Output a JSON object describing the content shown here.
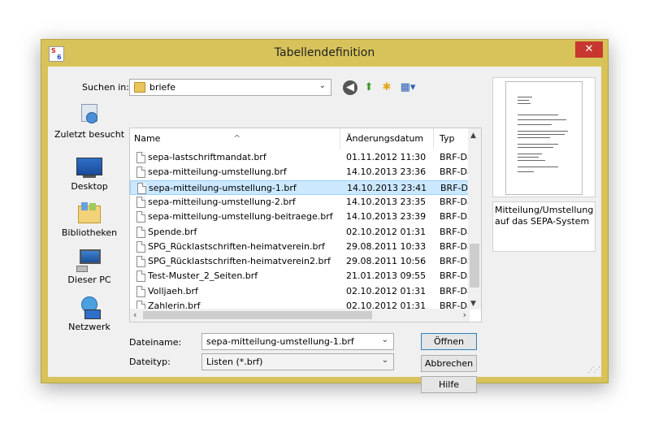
{
  "window": {
    "title": "Tabellendefinition",
    "close_glyph": "✕",
    "icon_s": "S",
    "icon_n": "6"
  },
  "lookin": {
    "label": "Suchen in:",
    "value": "briefe"
  },
  "places": [
    {
      "label": "Zuletzt besucht",
      "icon": "recent-places-icon"
    },
    {
      "label": "Desktop",
      "icon": "desktop-icon"
    },
    {
      "label": "Bibliotheken",
      "icon": "libraries-icon"
    },
    {
      "label": "Dieser PC",
      "icon": "this-pc-icon"
    },
    {
      "label": "Netzwerk",
      "icon": "network-icon"
    }
  ],
  "columns": {
    "name": "Name",
    "date": "Änderungsdatum",
    "type": "Typ"
  },
  "files": [
    {
      "name": "sepa-lastschriftmandat.brf",
      "date": "01.11.2012 11:30",
      "type": "BRF-Datei"
    },
    {
      "name": "sepa-mitteilung-umstellung.brf",
      "date": "14.10.2013 23:36",
      "type": "BRF-Datei"
    },
    {
      "name": "sepa-mitteilung-umstellung-1.brf",
      "date": "14.10.2013 23:41",
      "type": "BRF-Datei",
      "selected": true
    },
    {
      "name": "sepa-mitteilung-umstellung-2.brf",
      "date": "14.10.2013 23:35",
      "type": "BRF-Datei"
    },
    {
      "name": "sepa-mitteilung-umstellung-beitraege.brf",
      "date": "14.10.2013 23:39",
      "type": "BRF-Datei"
    },
    {
      "name": "Spende.brf",
      "date": "02.10.2012 01:31",
      "type": "BRF-Datei"
    },
    {
      "name": "SPG_Rücklastschriften-heimatverein.brf",
      "date": "29.08.2011 10:33",
      "type": "BRF-Datei"
    },
    {
      "name": "SPG_Rücklastschriften-heimatverein2.brf",
      "date": "29.08.2011 10:56",
      "type": "BRF-Datei"
    },
    {
      "name": "Test-Muster_2_Seiten.brf",
      "date": "21.01.2013 09:55",
      "type": "BRF-Datei"
    },
    {
      "name": "Volljaeh.brf",
      "date": "02.10.2012 01:31",
      "type": "BRF-Datei"
    },
    {
      "name": "Zahlerin.brf",
      "date": "02.10.2012 01:31",
      "type": "BRF-Datei"
    }
  ],
  "filename": {
    "label": "Dateiname:",
    "value": "sepa-mitteilung-umstellung-1.brf"
  },
  "filetype": {
    "label": "Dateityp:",
    "value": "Listen (*.brf)"
  },
  "buttons": {
    "open": "Öffnen",
    "cancel": "Abbrechen",
    "help": "Hilfe"
  },
  "preview": {
    "description": "Mitteilung/Umstellung auf das SEPA-System"
  },
  "colors": {
    "window_frame": "#d7c35a",
    "close": "#c7372f",
    "selection": "#cce8ff"
  }
}
